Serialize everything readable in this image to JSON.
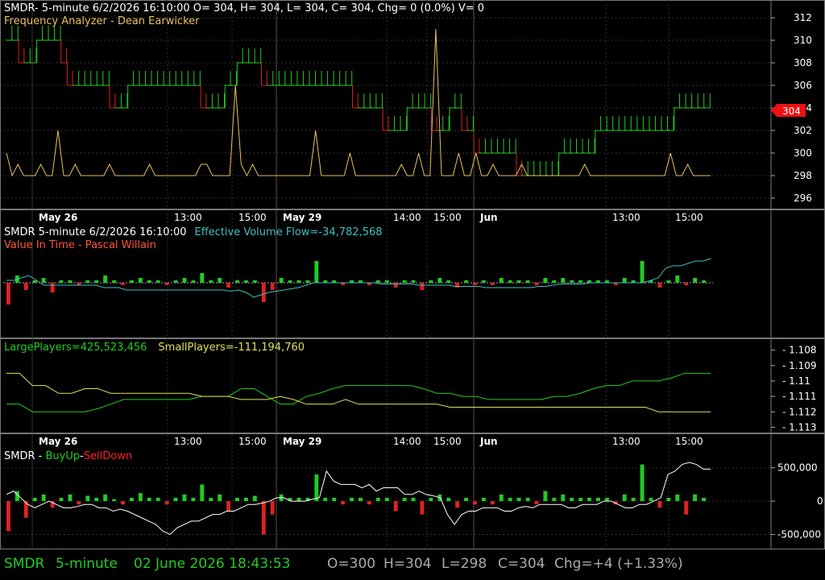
{
  "panels": {
    "price": {
      "header_symbol": "SMDR",
      "header_info": "- 5-minute 6/2/2026 16:10:00 O= 304, H= 304, L= 304, C= 304, Chg= 0 (0.0%) V= 0",
      "indicator": "Frequency Analyzer - Dean Earwicker",
      "last_price_badge": "304"
    },
    "volume_flow": {
      "header": "SMDR 5-minute  6/2/2026 16:10:00",
      "indicator": "Effective Volume Flow=-34,782,568",
      "subtitle": "Value In Time - Pascal Willain"
    },
    "players": {
      "large": "LargePlayers=425,523,456",
      "small": "SmallPlayers=-111,194,760"
    },
    "buy_sell": {
      "prefix": "SMDR - ",
      "buy": "BuyUp",
      "sep": "-",
      "sell": "SellDown"
    }
  },
  "status_bar": {
    "symbol": "SMDR",
    "interval": "5-minute",
    "datetime": "02 June 2026 18:43:53",
    "open": "O=300",
    "high": "H=304",
    "low": "L=298",
    "close": "C=304",
    "change": "Chg=+4 (+1.33%)"
  },
  "colors": {
    "up": "#22cc22",
    "down": "#dd2222",
    "analyzer": "#e8c060",
    "flow": "#40c0c0",
    "large": "#22cc22",
    "small": "#e0e060",
    "grid": "#333333",
    "text": "#ffffff",
    "badge": "#ee1111"
  },
  "chart_data": [
    {
      "type": "line",
      "name": "price",
      "ylim": [
        295,
        313
      ],
      "y_ticks": [
        296,
        298,
        300,
        302,
        304,
        306,
        308,
        310,
        312
      ],
      "x_labels": [
        "May 26",
        "13:00",
        "15:00",
        "May 29",
        "14:00",
        "15:00",
        "Jun",
        "13:00",
        "15:00"
      ],
      "close": [
        310,
        310,
        308,
        308,
        308,
        310,
        310,
        310,
        310,
        308,
        306,
        306,
        306,
        306,
        306,
        306,
        306,
        304,
        304,
        304,
        306,
        306,
        306,
        306,
        306,
        306,
        306,
        306,
        306,
        306,
        306,
        306,
        304,
        304,
        304,
        304,
        306,
        306,
        308,
        308,
        308,
        308,
        306,
        306,
        306,
        306,
        306,
        306,
        306,
        306,
        306,
        306,
        306,
        306,
        306,
        306,
        306,
        304,
        304,
        304,
        304,
        304,
        302,
        302,
        302,
        302,
        304,
        304,
        304,
        304,
        302,
        302,
        302,
        304,
        304,
        302,
        302,
        300,
        300,
        300,
        300,
        300,
        300,
        300,
        298,
        298,
        298,
        298,
        298,
        298,
        298,
        300,
        300,
        300,
        300,
        300,
        300,
        302,
        302,
        302,
        302,
        302,
        302,
        302,
        302,
        302,
        302,
        302,
        302,
        302,
        304,
        304,
        304,
        304,
        304,
        304
      ],
      "analyzer": [
        300,
        298,
        299,
        298,
        298,
        298,
        299,
        298,
        298,
        302,
        298,
        298,
        299,
        298,
        298,
        298,
        298,
        298,
        299,
        298,
        298,
        298,
        298,
        298,
        298,
        299,
        298,
        298,
        298,
        298,
        298,
        298,
        298,
        298,
        299,
        299,
        298,
        298,
        298,
        298,
        306,
        299,
        298,
        299,
        298,
        298,
        298,
        298,
        298,
        298,
        298,
        298,
        298,
        298,
        302,
        298,
        298,
        298,
        298,
        298,
        300,
        298,
        298,
        298,
        298,
        298,
        298,
        298,
        298,
        299,
        298,
        298,
        300,
        298,
        298,
        311,
        298,
        298,
        298,
        300,
        298,
        298,
        300,
        298,
        298,
        299,
        298,
        298,
        298,
        298,
        299,
        298,
        298,
        298,
        298,
        298,
        298,
        298,
        298,
        298,
        298,
        299,
        298,
        298,
        298,
        298,
        298,
        298,
        298,
        298,
        298,
        298,
        298,
        298,
        298,
        298,
        300,
        298,
        298,
        299,
        298,
        298,
        298,
        298
      ]
    },
    {
      "type": "line",
      "name": "effective-volume-flow",
      "series": [
        {
          "name": "Effective Volume Flow",
          "values": [
            0.1,
            0.1,
            0.2,
            0.3,
            0.1,
            -0.1,
            -0.1,
            -0.1,
            -0.1,
            -0.1,
            -0.1,
            -0.1,
            -0.1,
            -0.2,
            -0.2,
            -0.2,
            -0.3,
            -0.3,
            -0.3,
            -0.3,
            -0.3,
            -0.3,
            -0.3,
            -0.3,
            -0.3,
            -0.3,
            -0.3,
            -0.3,
            -0.3,
            -0.3,
            -0.35,
            -0.3,
            -0.4,
            -0.6,
            -0.5,
            -0.4,
            -0.35,
            -0.3,
            -0.25,
            -0.2,
            -0.1,
            0,
            0,
            0,
            0,
            0,
            0,
            0,
            0,
            0,
            -0.05,
            -0.05,
            -0.05,
            -0.05,
            -0.05,
            -0.1,
            -0.1,
            -0.1,
            -0.1,
            -0.1,
            -0.15,
            -0.15,
            -0.15,
            -0.15,
            -0.2,
            -0.2,
            -0.2,
            -0.2,
            -0.2,
            -0.2,
            -0.2,
            -0.15,
            -0.15,
            -0.1,
            -0.05,
            -0.05,
            -0.05,
            -0.05,
            0,
            0,
            0,
            0,
            0,
            0,
            0,
            0,
            0.1,
            0.2,
            0.6,
            0.7,
            0.7,
            0.8,
            0.9,
            0.9,
            1.0
          ]
        },
        {
          "name": "volume",
          "values": [
            -0.9,
            0.3,
            -0.3,
            0.1,
            0.2,
            -0.4,
            0.1,
            0.1,
            -0.1,
            0.1,
            0.1,
            0.3,
            0.1,
            -0.1,
            0.1,
            0.2,
            0.1,
            0.1,
            -0.1,
            0.1,
            0.2,
            0.1,
            0.4,
            0.1,
            0.2,
            -0.2,
            0.1,
            0.1,
            0.1,
            -0.8,
            -0.3,
            0.2,
            0.1,
            0.1,
            0.1,
            0.9,
            0.1,
            0.1,
            -0.1,
            0.1,
            0.1,
            -0.1,
            0.1,
            0.1,
            -0.2,
            0.1,
            0.1,
            -0.3,
            0.1,
            0.2,
            0.1,
            -0.2,
            0.1,
            -0.1,
            0.1,
            -0.1,
            0.2,
            0.1,
            0.1,
            0.1,
            -0.1,
            0.2,
            0.1,
            0.2,
            0.1,
            0.1,
            0.1,
            0.1,
            0.1,
            -0.1,
            0.2,
            0.1,
            0.9,
            0.1,
            -0.2,
            0.1,
            0.3,
            -0.1,
            0.2,
            0.1
          ]
        }
      ]
    },
    {
      "type": "line",
      "name": "players",
      "ylim": [
        -1.1135,
        -1.1075
      ],
      "y_ticks": [
        -1.108,
        -1.109,
        -1.11,
        -1.111,
        -1.112,
        -1.113
      ],
      "series": [
        {
          "name": "LargePlayers",
          "values": [
            -1.1115,
            -1.1115,
            -1.112,
            -1.112,
            -1.112,
            -1.112,
            -1.112,
            -1.1118,
            -1.1115,
            -1.1112,
            -1.1112,
            -1.1112,
            -1.1112,
            -1.1112,
            -1.1112,
            -1.111,
            -1.111,
            -1.111,
            -1.1105,
            -1.1105,
            -1.111,
            -1.1115,
            -1.1115,
            -1.111,
            -1.1108,
            -1.1105,
            -1.1103,
            -1.1103,
            -1.1103,
            -1.1103,
            -1.1103,
            -1.1103,
            -1.1105,
            -1.1108,
            -1.1108,
            -1.111,
            -1.111,
            -1.1112,
            -1.1112,
            -1.1112,
            -1.1112,
            -1.1112,
            -1.111,
            -1.111,
            -1.1108,
            -1.1105,
            -1.1103,
            -1.1103,
            -1.11,
            -1.11,
            -1.11,
            -1.1098,
            -1.1095,
            -1.1095,
            -1.1095
          ]
        },
        {
          "name": "SmallPlayers",
          "values": [
            -1.1095,
            -1.1095,
            -1.1103,
            -1.1103,
            -1.1108,
            -1.1108,
            -1.1105,
            -1.1105,
            -1.1108,
            -1.1108,
            -1.1108,
            -1.1108,
            -1.1108,
            -1.1108,
            -1.1108,
            -1.111,
            -1.111,
            -1.111,
            -1.1112,
            -1.1112,
            -1.1112,
            -1.111,
            -1.1112,
            -1.1115,
            -1.1115,
            -1.1115,
            -1.1112,
            -1.1115,
            -1.1115,
            -1.1115,
            -1.1115,
            -1.1115,
            -1.1115,
            -1.1115,
            -1.1117,
            -1.1117,
            -1.1117,
            -1.1117,
            -1.1117,
            -1.1117,
            -1.1117,
            -1.1117,
            -1.1117,
            -1.1117,
            -1.1117,
            -1.1117,
            -1.1117,
            -1.1117,
            -1.1117,
            -1.1117,
            -1.112,
            -1.112,
            -1.112,
            -1.112,
            -1.112
          ]
        }
      ]
    },
    {
      "type": "line",
      "name": "buyup-selldown",
      "ylim": [
        -700000,
        750000
      ],
      "y_ticks": [
        500000,
        0,
        -500000
      ],
      "y_tick_labels": [
        "500,000",
        "0",
        "-500,000"
      ],
      "series": [
        {
          "name": "BuyUp-SellDown",
          "values": [
            100000,
            150000,
            50000,
            -50000,
            -100000,
            -50000,
            0,
            -50000,
            -100000,
            -100000,
            -80000,
            -50000,
            -50000,
            -100000,
            -100000,
            -150000,
            -120000,
            -150000,
            -200000,
            -250000,
            -300000,
            -350000,
            -450000,
            -500000,
            -400000,
            -350000,
            -300000,
            -300000,
            -250000,
            -200000,
            -200000,
            -150000,
            -150000,
            -100000,
            -50000,
            -50000,
            -30000,
            0,
            50000,
            50000,
            0,
            0,
            0,
            30000,
            50000,
            450000,
            300000,
            250000,
            250000,
            250000,
            200000,
            250000,
            150000,
            200000,
            200000,
            200000,
            100000,
            100000,
            150000,
            100000,
            80000,
            50000,
            -200000,
            -350000,
            -200000,
            -150000,
            -150000,
            -100000,
            -100000,
            -100000,
            -150000,
            -150000,
            -100000,
            -80000,
            -100000,
            -50000,
            -50000,
            -50000,
            -50000,
            -100000,
            -100000,
            -50000,
            -50000,
            -50000,
            0,
            0,
            -50000,
            -100000,
            -100000,
            -50000,
            -50000,
            0,
            50000,
            400000,
            450000,
            550000,
            580000,
            550000,
            480000,
            480000
          ]
        },
        {
          "name": "bars",
          "values": [
            -450000,
            150000,
            -250000,
            50000,
            100000,
            -100000,
            50000,
            100000,
            -50000,
            80000,
            50000,
            100000,
            30000,
            -50000,
            50000,
            120000,
            50000,
            50000,
            -50000,
            50000,
            100000,
            50000,
            250000,
            50000,
            100000,
            -150000,
            50000,
            50000,
            80000,
            -500000,
            -200000,
            100000,
            50000,
            50000,
            50000,
            400000,
            50000,
            50000,
            -50000,
            50000,
            50000,
            -50000,
            50000,
            50000,
            -150000,
            50000,
            50000,
            -200000,
            50000,
            100000,
            50000,
            -100000,
            50000,
            -50000,
            50000,
            -50000,
            100000,
            50000,
            50000,
            50000,
            -50000,
            150000,
            50000,
            100000,
            50000,
            50000,
            50000,
            50000,
            50000,
            -50000,
            100000,
            50000,
            550000,
            50000,
            -100000,
            50000,
            100000,
            -200000,
            100000,
            50000
          ]
        }
      ]
    }
  ]
}
